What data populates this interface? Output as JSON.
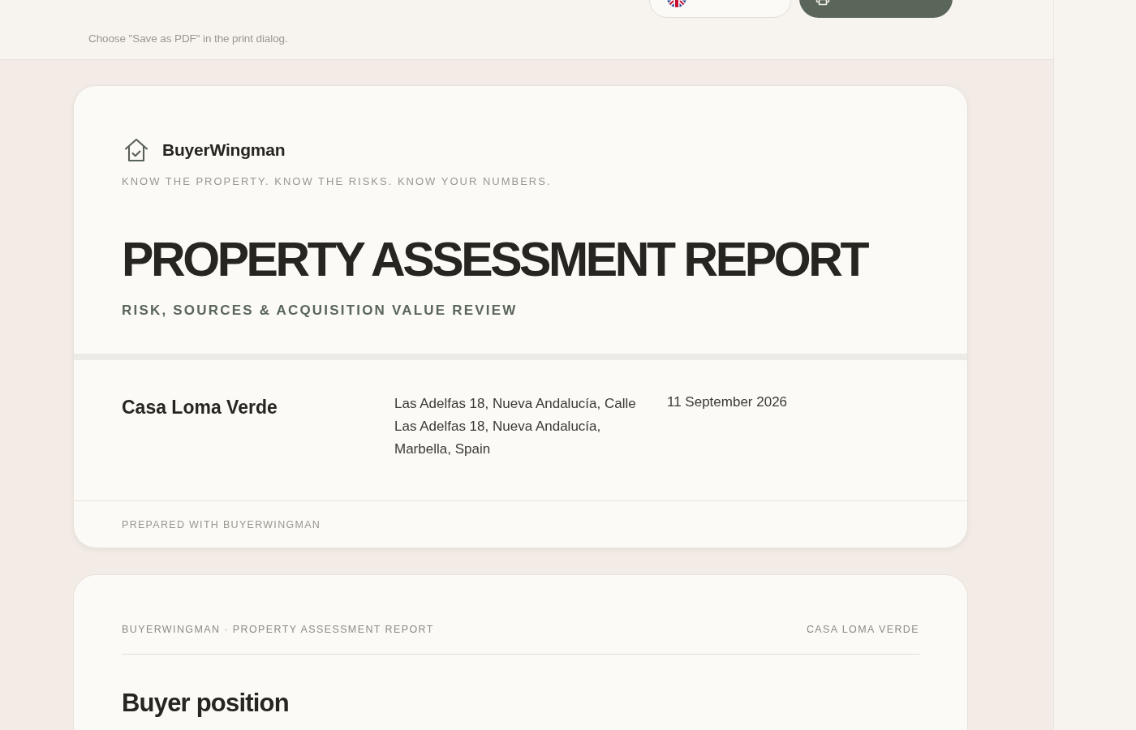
{
  "toolbar": {
    "hint": "Choose \"Save as PDF\" in the print dialog."
  },
  "cover": {
    "brand": "BuyerWingman",
    "tagline": "KNOW THE PROPERTY. KNOW THE RISKS. KNOW YOUR NUMBERS.",
    "title": "PROPERTY ASSESSMENT REPORT",
    "subtitle": "RISK, SOURCES & ACQUISITION VALUE REVIEW",
    "property_name": "Casa Loma Verde",
    "address": "Las Adelfas 18, Nueva Andalucía, Calle Las Adelfas 18, Nueva Andalucía, Marbella, Spain",
    "date": "11 September 2026",
    "footer": "PREPARED WITH BUYERWINGMAN"
  },
  "page_2": {
    "running_header": "BUYERWINGMAN · PROPERTY ASSESSMENT REPORT",
    "running_property": "CASA LOMA VERDE",
    "section_title": "Buyer position"
  }
}
